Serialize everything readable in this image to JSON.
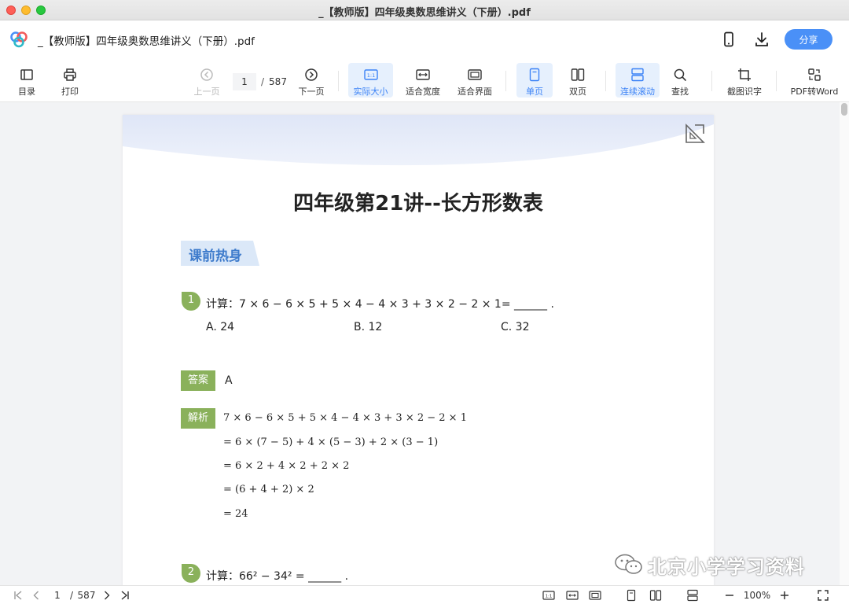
{
  "window": {
    "title": "_【教师版】四年级奥数思维讲义（下册）.pdf"
  },
  "header": {
    "doc_title": "_【教师版】四年级奥数思维讲义（下册）.pdf",
    "share_label": "分享"
  },
  "toolbar": {
    "toc": "目录",
    "print": "打印",
    "prev_page": "上一页",
    "current_page": "1",
    "total_pages": "587",
    "next_page": "下一页",
    "actual_size": "实际大小",
    "fit_width": "适合宽度",
    "fit_page": "适合界面",
    "single_page": "单页",
    "double_page": "双页",
    "continuous_scroll": "连续滚动",
    "search": "查找",
    "screenshot_ocr": "截图识字",
    "pdf_to_word": "PDF转Word"
  },
  "document": {
    "title": "四年级第21讲--长方形数表",
    "section": "课前热身",
    "q1": {
      "num": "1",
      "text": "计算：7 × 6 − 6 × 5 + 5 × 4 − 4 × 3 + 3 × 2 − 2 × 1= ______ .",
      "options": [
        "A. 24",
        "B. 12",
        "C. 32"
      ]
    },
    "answer_label": "答案",
    "answer_value": "A",
    "analysis_label": "解析",
    "steps": [
      "7 × 6 − 6 × 5 + 5 × 4 − 4 × 3 + 3 × 2 − 2 × 1",
      "= 6 × (7 − 5) + 4 × (5 − 3) + 2 × (3 − 1)",
      "= 6 × 2 + 4 × 2 + 2 × 2",
      "= (6 + 4 + 2) × 2",
      "= 24"
    ],
    "q2": {
      "num": "2",
      "text": "计算：66² − 34² = ______ ."
    }
  },
  "watermark": "北京小学学习资料",
  "bottombar": {
    "current_page": "1",
    "slash": "/",
    "total_pages": "587",
    "zoom": "100%"
  },
  "colors": {
    "accent": "#4a90f7",
    "green_tag": "#8ab15b",
    "section_blue": "#3f7ccc"
  }
}
